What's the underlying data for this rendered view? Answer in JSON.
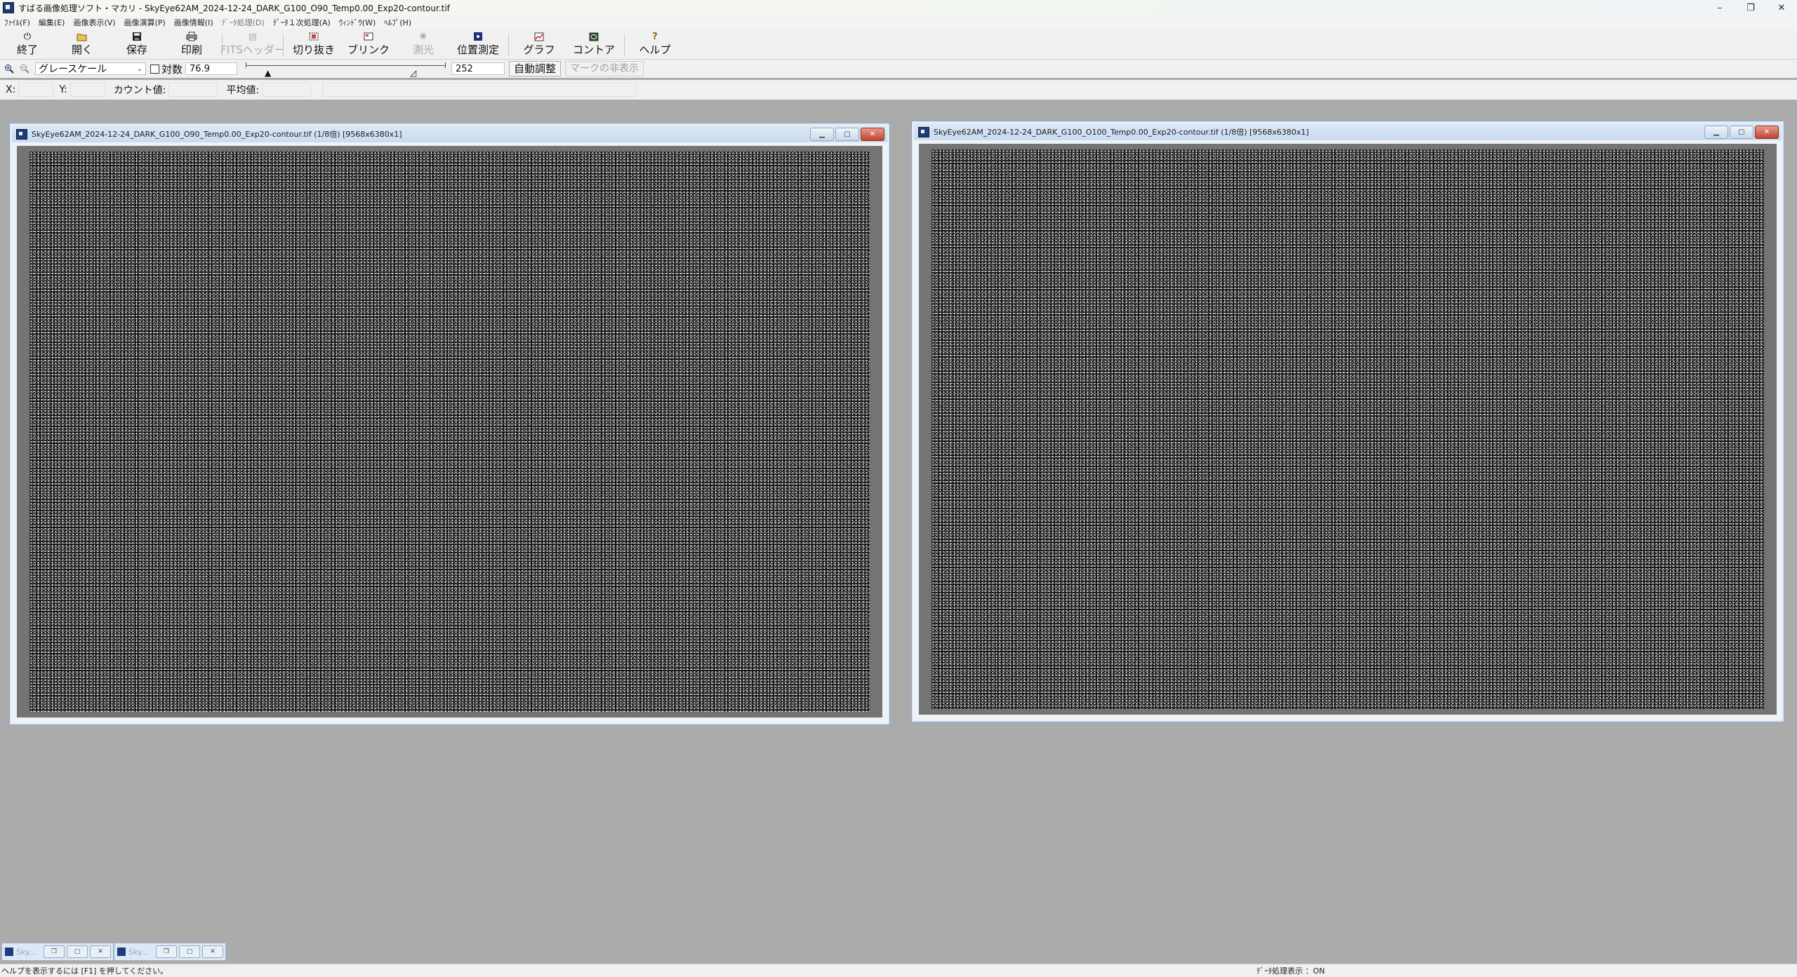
{
  "window": {
    "title": "すばる画像処理ソフト・マカリ - SkyEye62AM_2024-12-24_DARK_G100_O90_Temp0.00_Exp20-contour.tif",
    "minimize": "–",
    "restore": "❐",
    "close": "✕"
  },
  "menu": [
    "ﾌｧｲﾙ(F)",
    "編集(E)",
    "画像表示(V)",
    "画像演算(P)",
    "画像情報(I)",
    "ﾃﾞｰﾀ処理(D)",
    "ﾃﾞｰﾀ１次処理(A)",
    "ｳｨﾝﾄﾞｳ(W)",
    "ﾍﾙﾌﾟ(H)"
  ],
  "toolbar": {
    "exit": "終了",
    "open": "開く",
    "save": "保存",
    "print": "印刷",
    "fits_header": "FITSヘッダー",
    "crop": "切り抜き",
    "blink": "ブリンク",
    "photometry": "測光",
    "astrometry": "位置測定",
    "graph": "グラフ",
    "contour": "コントア",
    "help": "ヘルプ"
  },
  "display": {
    "mode": "グレースケール",
    "log_label": "対数",
    "log_checked": false,
    "min_value": "76.9",
    "max_value": "252",
    "auto_adjust": "自動調整",
    "hide_marks": "マークの非表示"
  },
  "info": {
    "x_label": "X:",
    "y_label": "Y:",
    "count_label": "カウント値:",
    "mean_label": "平均値:"
  },
  "windows": [
    {
      "title": "SkyEye62AM_2024-12-24_DARK_G100_O90_Temp0.00_Exp20-contour.tif (1/8倍) [9568x6380x1]"
    },
    {
      "title": "SkyEye62AM_2024-12-24_DARK_G100_O100_Temp0.00_Exp20-contour.tif (1/8倍) [9568x6380x1]"
    }
  ],
  "minimized": [
    {
      "label": "Sky..."
    },
    {
      "label": "Sky..."
    }
  ],
  "status": {
    "help_hint": "ヘルプを表示するには [F1] を押してください。",
    "data_processing": "ﾃﾞｰﾀ処理表示 ：ON"
  }
}
